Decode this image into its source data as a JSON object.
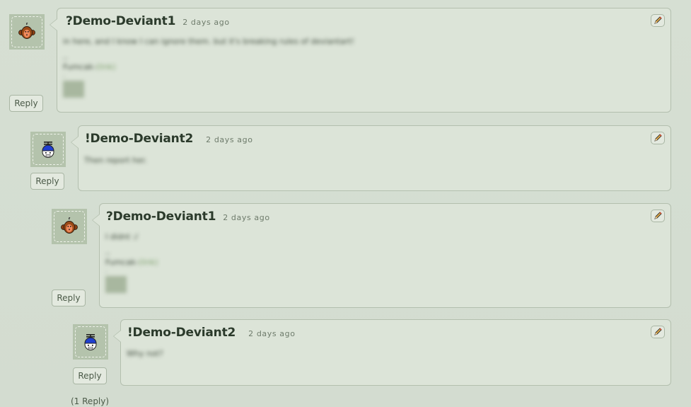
{
  "comments": [
    {
      "author": "?Demo-Deviant1",
      "time": "2 days ago",
      "avatar_icon": "monkey-avatar-icon",
      "body": {
        "text": "in here, and I know I can ignore them. but it's breaking rules of deviantart!",
        "sig_separator": "--",
        "sig_name": "Fumcak-",
        "sig_link": "(link)",
        "sig_dot": "."
      },
      "reply_label": "Reply",
      "edit_icon": "pencil-icon"
    },
    {
      "author": "!Demo-Deviant2",
      "time": "2 days ago",
      "avatar_icon": "propeller-cap-avatar-icon",
      "body": {
        "text": "Then report her."
      },
      "reply_label": "Reply",
      "edit_icon": "pencil-icon"
    },
    {
      "author": "?Demo-Deviant1",
      "time": "2 days ago",
      "avatar_icon": "monkey-avatar-icon",
      "body": {
        "text": "I didnt :/",
        "sig_separator": "--",
        "sig_name": "Fumcak-",
        "sig_link": "(link)",
        "sig_dot": "."
      },
      "reply_label": "Reply",
      "edit_icon": "pencil-icon"
    },
    {
      "author": "!Demo-Deviant2",
      "time": "2 days ago",
      "avatar_icon": "propeller-cap-avatar-icon",
      "body": {
        "text": "Why not?"
      },
      "reply_label": "Reply",
      "edit_icon": "pencil-icon"
    }
  ],
  "reply_count": "(1 Reply)",
  "colors": {
    "background": "#d6dfd3",
    "bubble": "#dce4d8",
    "author": "#2b3a2b",
    "link": "#7ea06d"
  }
}
